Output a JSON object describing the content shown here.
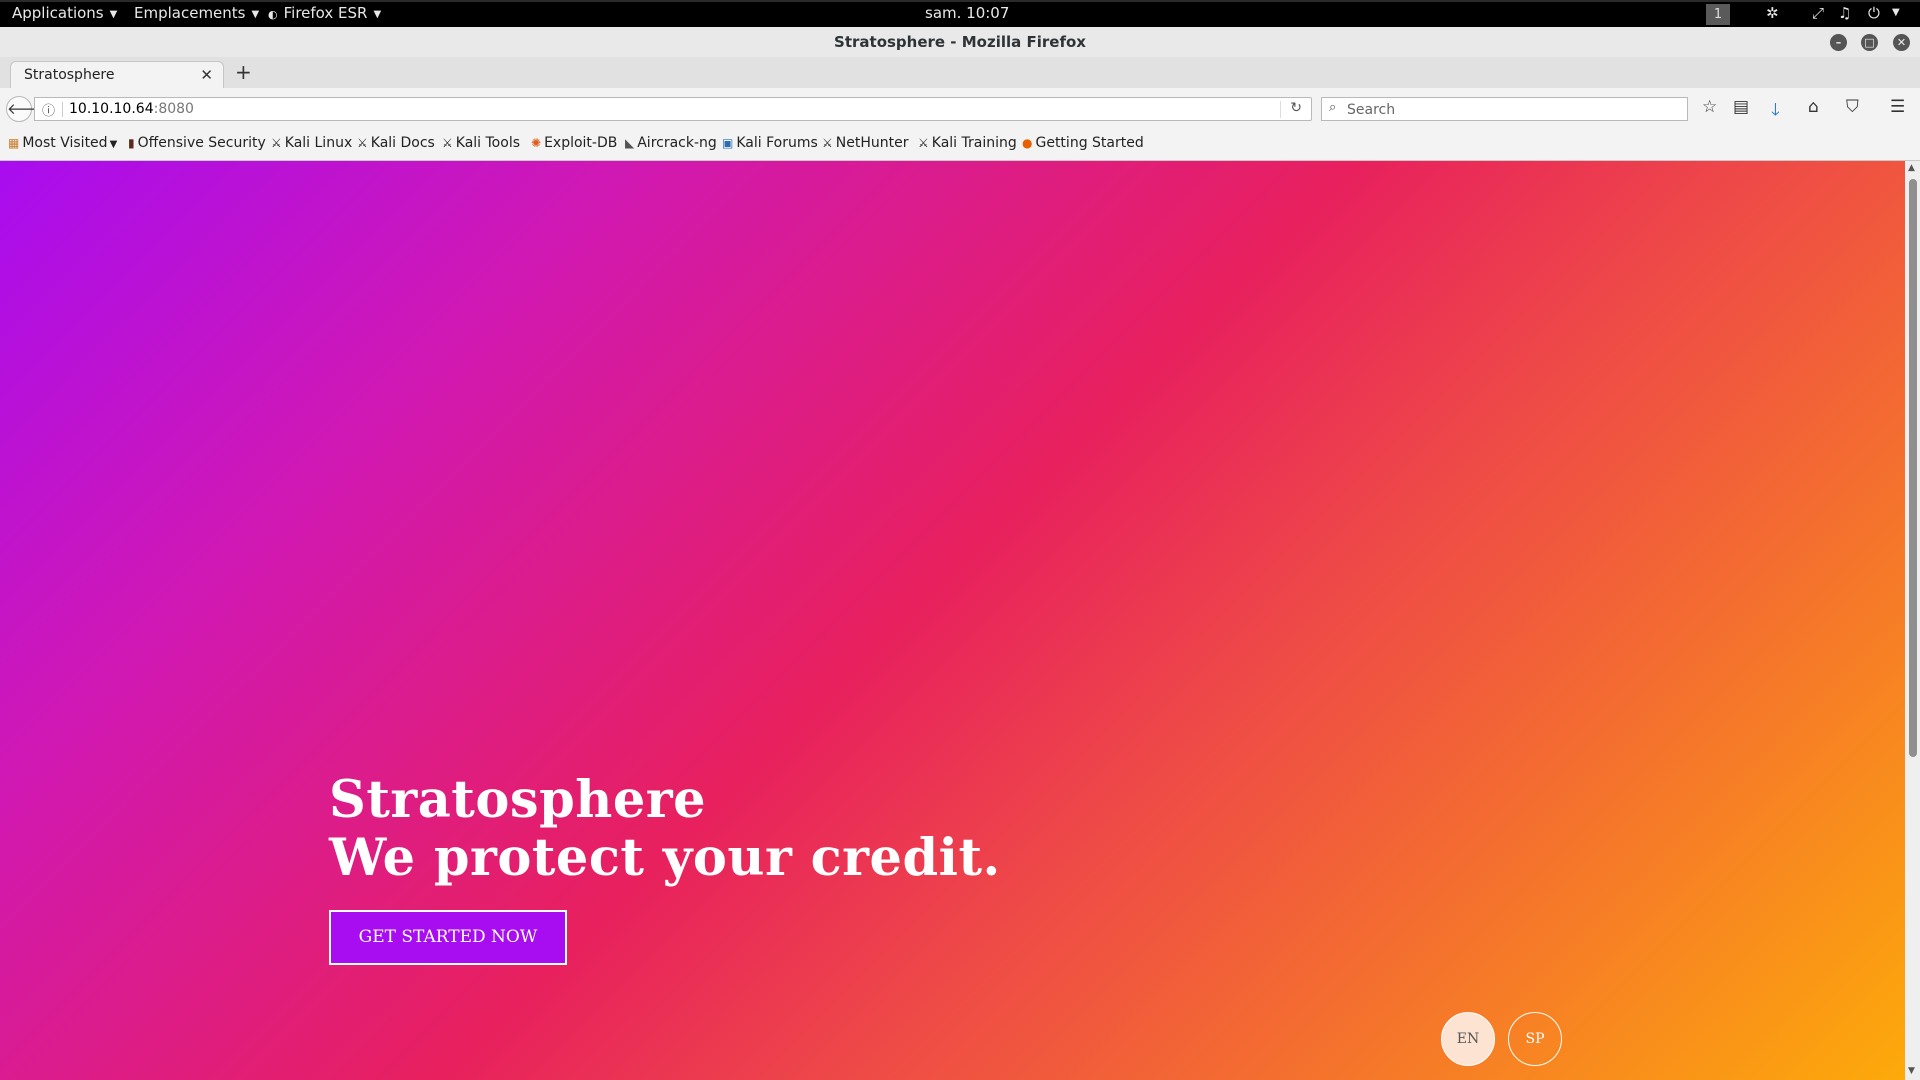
{
  "topbar": {
    "applications": "Applications",
    "places": "Emplacements",
    "firefox_menu": "Firefox ESR",
    "clock": "sam. 10:07",
    "workspace": "1"
  },
  "window": {
    "title": "Stratosphere - Mozilla Firefox"
  },
  "tabs": [
    {
      "title": "Stratosphere"
    }
  ],
  "navbar": {
    "url_host": "10.10.10.64",
    "url_port": ":8080",
    "search_placeholder": "Search"
  },
  "bookmarks": [
    {
      "label": "Most Visited",
      "icon": "folder-icon"
    },
    {
      "label": "Offensive Security",
      "icon": "offsec-icon"
    },
    {
      "label": "Kali Linux",
      "icon": "kali-icon"
    },
    {
      "label": "Kali Docs",
      "icon": "kali-icon"
    },
    {
      "label": "Kali Tools",
      "icon": "kali-icon"
    },
    {
      "label": "Exploit-DB",
      "icon": "exploitdb-icon"
    },
    {
      "label": "Aircrack-ng",
      "icon": "aircrack-icon"
    },
    {
      "label": "Kali Forums",
      "icon": "forums-icon"
    },
    {
      "label": "NetHunter",
      "icon": "kali-icon"
    },
    {
      "label": "Kali Training",
      "icon": "kali-icon"
    },
    {
      "label": "Getting Started",
      "icon": "firefox-icon"
    }
  ],
  "hero": {
    "line1": "Stratosphere",
    "line2": "We protect your credit.",
    "cta": "GET STARTED NOW"
  },
  "languages": {
    "en": "EN",
    "sp": "SP"
  },
  "colors": {
    "gradient_start": "#a80cf0",
    "gradient_mid": "#e8205e",
    "gradient_end": "#fdaa0a",
    "cta_bg": "#a70df0"
  }
}
